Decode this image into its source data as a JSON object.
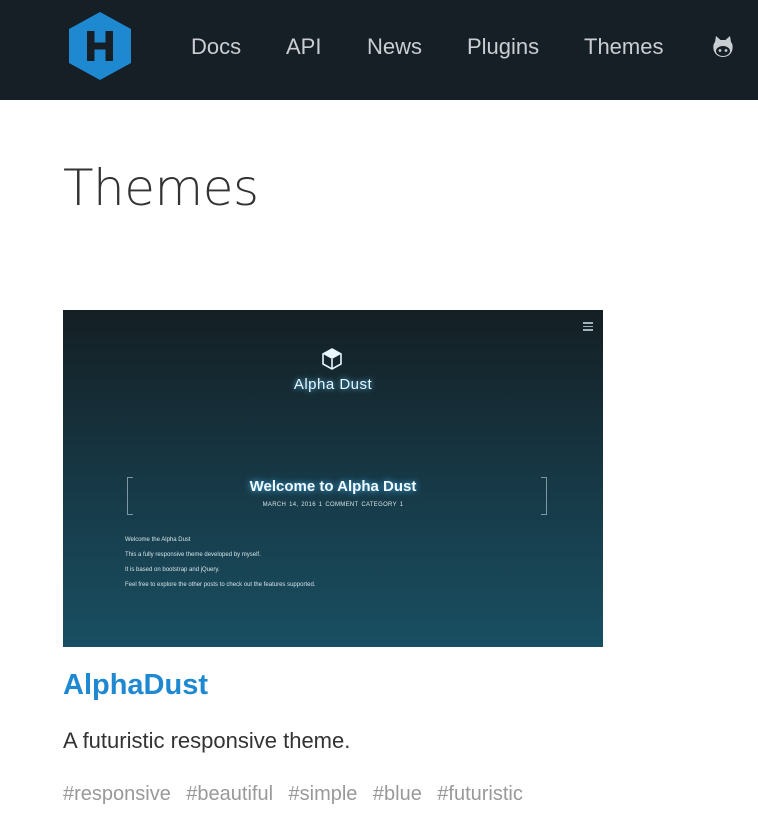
{
  "header": {
    "nav": [
      {
        "label": "Docs"
      },
      {
        "label": "API"
      },
      {
        "label": "News"
      },
      {
        "label": "Plugins"
      },
      {
        "label": "Themes"
      }
    ],
    "logo_icon": "hexo-logo-icon",
    "github_icon": "github-icon",
    "colors": {
      "background": "#171f26",
      "logo": "#1e88d0"
    }
  },
  "page": {
    "title": "Themes"
  },
  "theme": {
    "preview": {
      "brand": "Alpha Dust",
      "welcome": "Welcome to Alpha Dust",
      "meta": "MARCH 14, 2016   1 COMMENT   CATEGORY 1",
      "lines": [
        "Welcome the Alpha Dust",
        "This a fully responsive theme developed by myself.",
        "It is based on bootstrap and jQuery.",
        "Feel free to explore the other posts to check out the features supported."
      ]
    },
    "name": "AlphaDust",
    "description": "A futuristic responsive theme.",
    "tags": [
      "#responsive",
      "#beautiful",
      "#simple",
      "#blue",
      "#futuristic"
    ]
  }
}
